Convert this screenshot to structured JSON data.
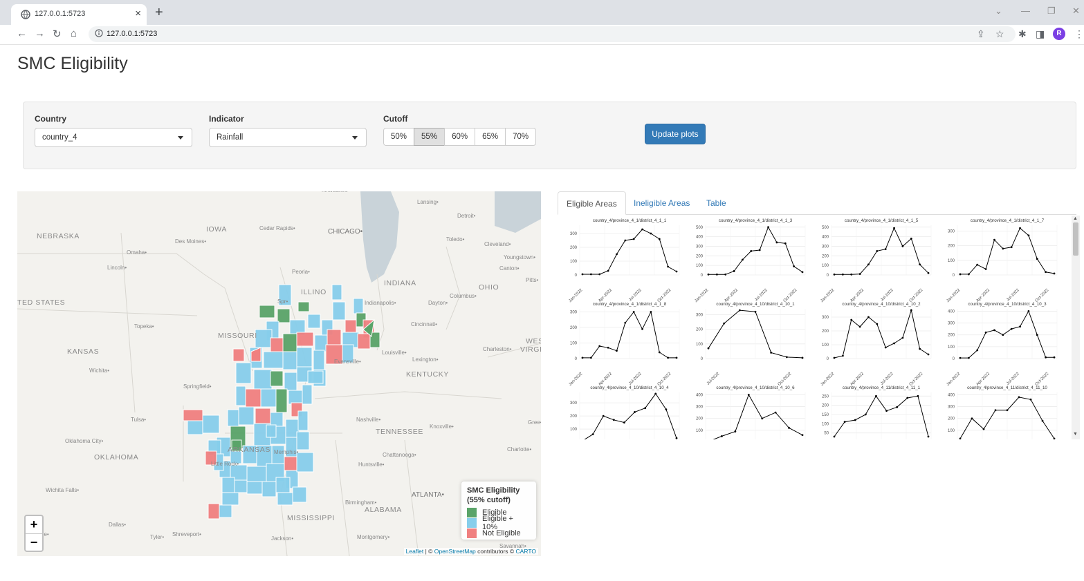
{
  "browser": {
    "tab_title": "127.0.0.1:5723",
    "url": "127.0.0.1:5723",
    "avatar_letter": "R"
  },
  "page": {
    "title": "SMC Eligibility"
  },
  "controls": {
    "country_label": "Country",
    "country_value": "country_4",
    "indicator_label": "Indicator",
    "indicator_value": "Rainfall",
    "cutoff_label": "Cutoff",
    "cutoff_options": [
      "50%",
      "55%",
      "60%",
      "65%",
      "70%"
    ],
    "cutoff_selected": "55%",
    "update_label": "Update plots"
  },
  "map": {
    "labels": [
      {
        "text": "NEBRASKA",
        "kind": "state"
      },
      {
        "text": "IOWA",
        "kind": "state"
      },
      {
        "text": "KANSAS",
        "kind": "state"
      },
      {
        "text": "MISSOURI",
        "kind": "state"
      },
      {
        "text": "OKLAHOMA",
        "kind": "state"
      },
      {
        "text": "INDIANA",
        "kind": "state"
      },
      {
        "text": "OHIO",
        "kind": "state"
      },
      {
        "text": "KENTUCKY",
        "kind": "state"
      },
      {
        "text": "TENNESSEE",
        "kind": "state"
      },
      {
        "text": "MISSISSIPPI",
        "kind": "state"
      },
      {
        "text": "ALABAMA",
        "kind": "state"
      },
      {
        "text": "ILLINO",
        "kind": "state"
      },
      {
        "text": "ARKANSAS",
        "kind": "state"
      },
      {
        "text": "TED STATES",
        "kind": "country"
      },
      {
        "text": "WES",
        "kind": "state"
      },
      {
        "text": "VIRGI",
        "kind": "state"
      },
      {
        "text": "Cedar Rapids",
        "kind": "city"
      },
      {
        "text": "CHICAGO",
        "kind": "bigcity"
      },
      {
        "text": "Lansing",
        "kind": "city"
      },
      {
        "text": "Detroit",
        "kind": "city"
      },
      {
        "text": "Des Moines",
        "kind": "city"
      },
      {
        "text": "Omaha",
        "kind": "city"
      },
      {
        "text": "Toledo",
        "kind": "city"
      },
      {
        "text": "Cleveland",
        "kind": "city"
      },
      {
        "text": "Youngstown",
        "kind": "city"
      },
      {
        "text": "Canton",
        "kind": "city"
      },
      {
        "text": "Lincoln",
        "kind": "city"
      },
      {
        "text": "Peoria",
        "kind": "city"
      },
      {
        "text": "Pitts",
        "kind": "city"
      },
      {
        "text": "Columbus",
        "kind": "city"
      },
      {
        "text": "Indianapolis",
        "kind": "city"
      },
      {
        "text": "Dayton",
        "kind": "city"
      },
      {
        "text": "Topeka",
        "kind": "city"
      },
      {
        "text": "Cincinnati",
        "kind": "city"
      },
      {
        "text": "Charleston",
        "kind": "city"
      },
      {
        "text": "Louisville",
        "kind": "city"
      },
      {
        "text": "Evansville",
        "kind": "city"
      },
      {
        "text": "Lexington",
        "kind": "city"
      },
      {
        "text": "Wichita",
        "kind": "city"
      },
      {
        "text": "Springfield",
        "kind": "city"
      },
      {
        "text": "Spr",
        "kind": "city"
      },
      {
        "text": "Tulsa",
        "kind": "city"
      },
      {
        "text": "Nashville",
        "kind": "city"
      },
      {
        "text": "Knoxville",
        "kind": "city"
      },
      {
        "text": "Gree",
        "kind": "city"
      },
      {
        "text": "Oklahoma City",
        "kind": "city"
      },
      {
        "text": "Memphis",
        "kind": "city"
      },
      {
        "text": "Charlotte",
        "kind": "city"
      },
      {
        "text": "Chattanooga",
        "kind": "city"
      },
      {
        "text": "Little Rock",
        "kind": "city"
      },
      {
        "text": "Huntsville",
        "kind": "city"
      },
      {
        "text": "Wichita Falls",
        "kind": "city"
      },
      {
        "text": "ATLANTA",
        "kind": "bigcity"
      },
      {
        "text": "Birmingham",
        "kind": "city"
      },
      {
        "text": "Dallas",
        "kind": "city"
      },
      {
        "text": "Tyler",
        "kind": "city"
      },
      {
        "text": "Shreveport",
        "kind": "city"
      },
      {
        "text": "Jackson",
        "kind": "city"
      },
      {
        "text": "Montgomery",
        "kind": "city"
      },
      {
        "text": "Savannah",
        "kind": "city"
      },
      {
        "text": "Milwaukee",
        "kind": "city"
      },
      {
        "text": "ne",
        "kind": "city"
      }
    ],
    "legend_title_1": "SMC Eligibility",
    "legend_title_2": "(55% cutoff)",
    "legend_items": [
      {
        "label": "Eligible",
        "color": "#5aa469"
      },
      {
        "label": "Eligible + 10%",
        "color": "#87ceeb"
      },
      {
        "label": "Not Eligible",
        "color": "#f08080"
      }
    ],
    "zoom_in": "+",
    "zoom_out": "−",
    "attribution_leaflet": "Leaflet",
    "attribution_sep": " | © ",
    "attribution_osm": "OpenStreetMap",
    "attribution_mid": " contributors © ",
    "attribution_carto": "CARTO"
  },
  "panel_tabs": [
    "Eligible Areas",
    "Ineligible Areas",
    "Table"
  ],
  "panel_tab_active": "Eligible Areas",
  "chart_data": [
    {
      "type": "line",
      "title": "country_4/province_4_1/district_4_1_1",
      "x": [
        "Jan-2022",
        "Apr-2022",
        "Jul-2022",
        "Oct-2022"
      ],
      "yticks": [
        0,
        100,
        200,
        300
      ],
      "ylim": [
        0,
        360
      ],
      "values": [
        5,
        5,
        5,
        30,
        150,
        250,
        260,
        330,
        300,
        260,
        60,
        25
      ]
    },
    {
      "type": "line",
      "title": "country_4/province_4_1/district_4_1_3",
      "x": [
        "Jan-2022",
        "Apr-2022",
        "Jul-2022",
        "Oct-2022"
      ],
      "yticks": [
        0,
        100,
        200,
        300,
        400,
        500
      ],
      "ylim": [
        0,
        520
      ],
      "values": [
        5,
        5,
        5,
        40,
        160,
        250,
        260,
        500,
        340,
        330,
        90,
        30
      ]
    },
    {
      "type": "line",
      "title": "country_4/province_4_1/district_4_1_5",
      "x": [
        "Jan-2022",
        "Apr-2022",
        "Jul-2022",
        "Oct-2022"
      ],
      "yticks": [
        0,
        100,
        200,
        300,
        400,
        500
      ],
      "ylim": [
        0,
        520
      ],
      "values": [
        5,
        5,
        5,
        10,
        110,
        250,
        270,
        490,
        300,
        380,
        110,
        20
      ]
    },
    {
      "type": "line",
      "title": "country_4/province_4_1/district_4_1_7",
      "x": [
        "Jan-2022",
        "Apr-2022",
        "Jul-2022",
        "Oct-2022"
      ],
      "yticks": [
        0,
        100,
        200,
        300
      ],
      "ylim": [
        0,
        340
      ],
      "values": [
        5,
        5,
        70,
        40,
        240,
        180,
        190,
        320,
        270,
        110,
        20,
        10
      ]
    },
    {
      "type": "line",
      "title": "country_4/province_4_1/district_4_1_8",
      "x": [
        "Jan-2022",
        "Apr-2022",
        "Jul-2022",
        "Oct-2022"
      ],
      "yticks": [
        0,
        100,
        200,
        300
      ],
      "ylim": [
        0,
        320
      ],
      "values": [
        5,
        5,
        80,
        70,
        50,
        230,
        300,
        190,
        300,
        40,
        5,
        5
      ]
    },
    {
      "type": "line",
      "title": "country_4/province_4_10/district_4_10_1",
      "x": [
        "Jul-2022",
        "Oct-2022"
      ],
      "yticks": [
        0,
        100,
        200,
        300
      ],
      "ylim": [
        0,
        340
      ],
      "values": [
        70,
        240,
        330,
        320,
        40,
        10,
        5
      ]
    },
    {
      "type": "line",
      "title": "country_4/province_4_10/district_4_10_2",
      "x": [
        "Jan-2022",
        "Apr-2022",
        "Jul-2022",
        "Oct-2022"
      ],
      "yticks": [
        0,
        100,
        200,
        300
      ],
      "ylim": [
        0,
        360
      ],
      "values": [
        5,
        20,
        280,
        230,
        300,
        250,
        80,
        110,
        150,
        350,
        70,
        30
      ]
    },
    {
      "type": "line",
      "title": "country_4/province_4_10/district_4_10_3",
      "x": [
        "Jan-2022",
        "Apr-2022",
        "Jul-2022",
        "Oct-2022"
      ],
      "yticks": [
        0,
        100,
        200,
        300,
        400
      ],
      "ylim": [
        0,
        420
      ],
      "values": [
        5,
        5,
        70,
        220,
        240,
        200,
        250,
        270,
        400,
        200,
        10,
        10
      ]
    },
    {
      "type": "line",
      "title": "country_4/province_4_10/district_4_10_4",
      "x": [],
      "yticks": [
        100,
        200,
        300
      ],
      "ylim": [
        0,
        380
      ],
      "values": [
        10,
        60,
        200,
        170,
        150,
        230,
        260,
        370,
        250,
        30
      ]
    },
    {
      "type": "line",
      "title": "country_4/province_4_10/district_4_10_6",
      "x": [],
      "yticks": [
        100,
        200,
        300,
        400
      ],
      "ylim": [
        0,
        420
      ],
      "values": [
        5,
        50,
        90,
        400,
        200,
        250,
        120,
        60
      ]
    },
    {
      "type": "line",
      "title": "country_4/province_4_11/district_4_11_1",
      "x": [],
      "yticks": [
        50,
        100,
        150,
        200,
        250
      ],
      "ylim": [
        0,
        270
      ],
      "values": [
        30,
        110,
        120,
        150,
        250,
        170,
        190,
        240,
        250,
        30
      ]
    },
    {
      "type": "line",
      "title": "country_4/province_4_11/district_4_11_10",
      "x": [],
      "yticks": [
        100,
        200,
        300,
        400
      ],
      "ylim": [
        0,
        420
      ],
      "values": [
        30,
        200,
        110,
        270,
        270,
        380,
        360,
        180,
        30
      ]
    }
  ]
}
